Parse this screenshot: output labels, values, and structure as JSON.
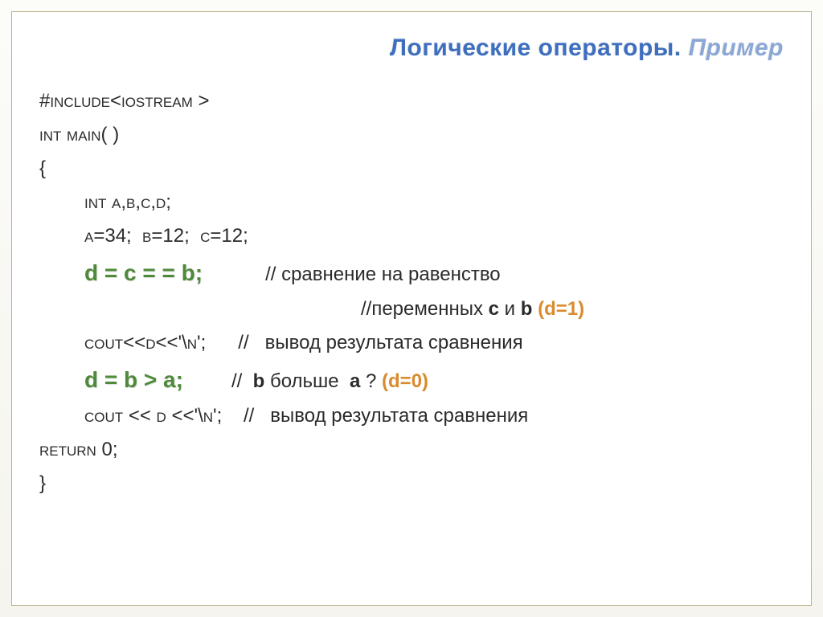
{
  "title": {
    "part1": "Логические операторы",
    "dot": ". ",
    "part2": "Пример"
  },
  "code": {
    "l1": "#include<iostream >",
    "l2": "int main( )",
    "l3": "{",
    "l4": "int a,b,c,d;",
    "l5": "a=34;  b=12;  c=12;",
    "l6a": "d = c = = b;",
    "l6b": "// сравнение на равенство",
    "l7a": "//переменных ",
    "l7b": "c",
    "l7c": " и ",
    "l7d": "b ",
    "l7e": "(d=1)",
    "l8a": "cout<<d<<'\\n';",
    "l8b": "//   вывод результата сравнения",
    "l9a": "d = b > a;",
    "l9b": "//  ",
    "l9c": "b",
    "l9d": " больше  ",
    "l9e": "a",
    "l9f": " ? ",
    "l9g": "(d=0)",
    "l10a": "cout << d <<'\\n';",
    "l10b": "//   вывод результата сравнения",
    "l11": "return 0;",
    "l12": "}"
  }
}
